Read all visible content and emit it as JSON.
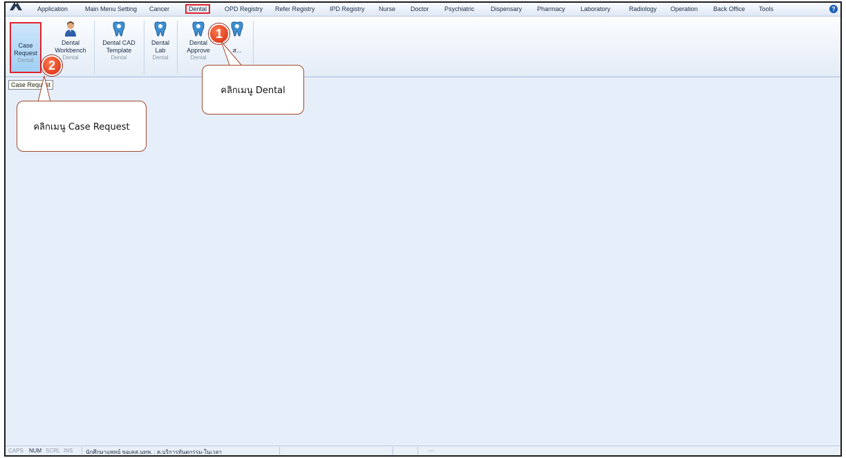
{
  "menu": {
    "items": [
      "Application",
      "Main Menu Setting",
      "Cancer",
      "Dental",
      "OPD Registry",
      "Refer Registry",
      "IPD Registry",
      "Nurse",
      "Doctor",
      "Psychiatric",
      "Dispensary",
      "Pharmacy",
      "Laboratory",
      "Radiology",
      "Operation",
      "Back Office",
      "Tools"
    ],
    "help_glyph": "?",
    "highlight_color": "#e0212a"
  },
  "ribbon": {
    "buttons": [
      {
        "label1": "Case",
        "label2": "Request",
        "group": "Dental",
        "icon": "blank-icon"
      },
      {
        "label1": "Dental",
        "label2": "Workbench",
        "group": "Dental",
        "icon": "doctor-person-icon"
      },
      {
        "label1": "Dental CAD",
        "label2": "Template",
        "group": "Dental",
        "icon": "tooth-icon"
      },
      {
        "label1": "Dental",
        "label2": "Lab",
        "group": "Dental",
        "icon": "tooth-icon"
      },
      {
        "label1": "Dental",
        "label2": "Approve",
        "group": "Dental",
        "icon": "tooth-icon"
      },
      {
        "label1": "ส...",
        "label2": "",
        "group": "",
        "icon": "tooth-icon"
      }
    ]
  },
  "tooltip": "Case Request",
  "annotations": {
    "badge1": "1",
    "badge2": "2",
    "callout1": "คลิกเมนู Dental",
    "callout2": "คลิกเมนู Case Request",
    "badge_color": "#d4270f"
  },
  "statusbar": {
    "caps": "CAPS",
    "num": "NUM",
    "scrl": "SCRL",
    "ins": "INS",
    "user": "นักศึกษาแพทย์ ขอเคส,นทพ. : ค.บริการทันตกรรม-ในเวลา",
    "extra": "---"
  }
}
